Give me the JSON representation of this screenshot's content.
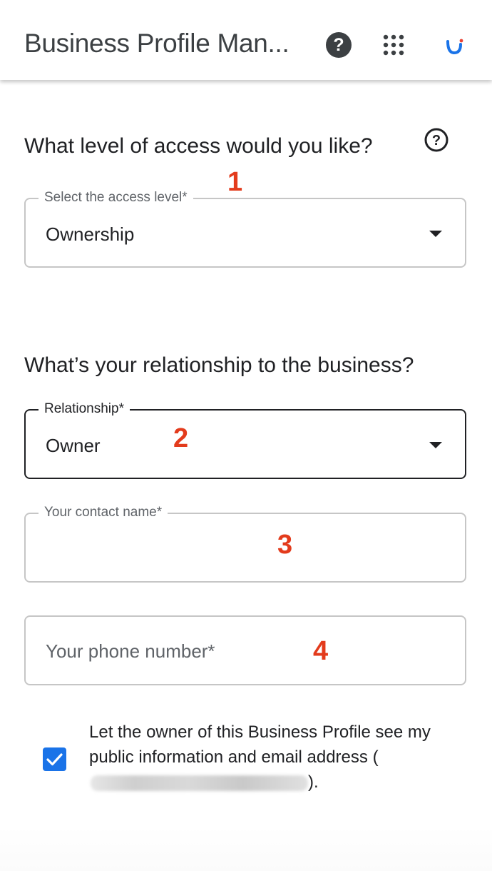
{
  "header": {
    "title": "Business Profile Man...",
    "help_icon": "help-circle-filled-icon",
    "help_glyph": "?",
    "apps_icon": "apps-grid-icon",
    "account_icon": "account-avatar-icon"
  },
  "access_section": {
    "heading": "What level of access would you like?",
    "help_icon": "help-outline-icon",
    "help_glyph": "?",
    "field": {
      "label": "Select the access level*",
      "value": "Ownership"
    }
  },
  "relationship_section": {
    "heading": "What’s your relationship to the business?",
    "relationship_field": {
      "label": "Relationship*",
      "value": "Owner"
    },
    "contact_name_field": {
      "label": "Your contact name*",
      "value": ""
    },
    "phone_field": {
      "placeholder": "Your phone number*",
      "value": ""
    }
  },
  "consent": {
    "checked": true,
    "text": "Let the owner of this Business Profile see my public information and email address",
    "open_paren": "(",
    "close_paren": ")."
  },
  "annotations": [
    "1",
    "2",
    "3",
    "4"
  ],
  "colors": {
    "accent": "#1a73e8",
    "annotation": "#e33b1c",
    "text": "#202124",
    "secondary_text": "#5f6368",
    "border": "#c6c6c6"
  }
}
